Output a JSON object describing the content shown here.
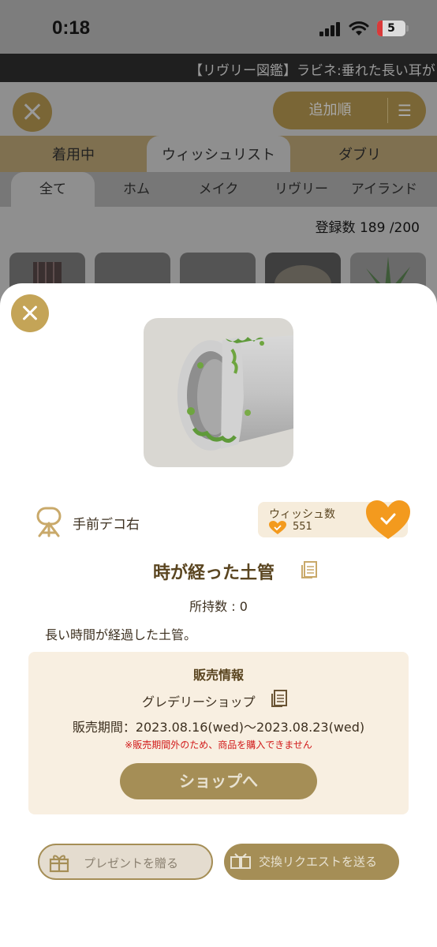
{
  "status_bar": {
    "time": "0:18",
    "battery": "5"
  },
  "ticker": {
    "text": "【リヴリー図鑑】ラビネ:垂れた長い耳が"
  },
  "background": {
    "sort_label": "追加順",
    "tabs": [
      "着用中",
      "ウィッシュリスト",
      "ダブリ"
    ],
    "active_tab": "ウィッシュリスト",
    "categories": [
      "全て",
      "ホム",
      "メイク",
      "リヴリー",
      "アイランド"
    ],
    "active_category": "全て",
    "count": "登録数  189 /200"
  },
  "item": {
    "category": "手前デコ右",
    "wish_label": "ウィッシュ数",
    "wish_count": "551",
    "name": "時が経った土管",
    "owned": "所持数 : 0",
    "description": "長い時間が経過した土管。"
  },
  "sale": {
    "title": "販売情報",
    "shop": "グレデリーショップ",
    "period": "販売期間：2023.08.16(wed)～2023.08.23(wed)",
    "warning": "※販売期間外のため、商品を購入できません",
    "shop_button": "ショップへ"
  },
  "actions": {
    "present": "プレゼントを贈る",
    "trade": "交換リクエストを送る"
  },
  "colors": {
    "accent": "#c4a457",
    "button": "#a58e56",
    "heart": "#f39a1e",
    "warning": "#d11a1a"
  }
}
